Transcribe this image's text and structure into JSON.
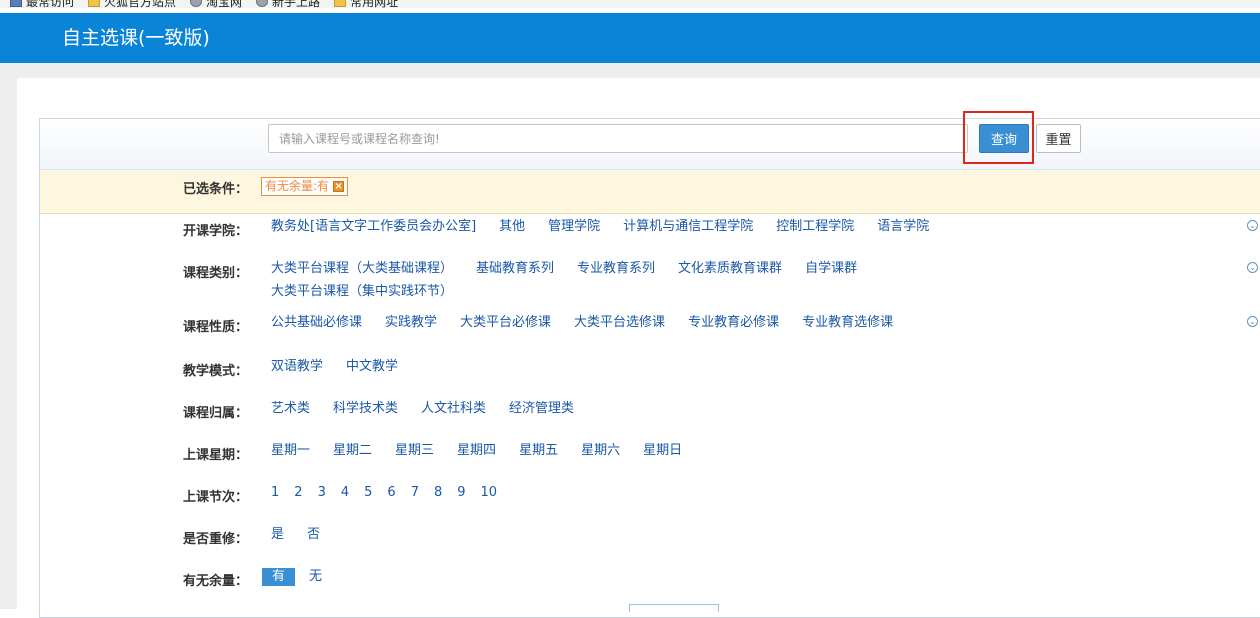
{
  "bookmarks": [
    {
      "label": "最常访问",
      "icon": "bookmark-star-icon"
    },
    {
      "label": "火狐官方站点",
      "icon": "folder-icon"
    },
    {
      "label": "淘宝网",
      "icon": "globe-icon"
    },
    {
      "label": "新手上路",
      "icon": "globe-icon"
    },
    {
      "label": "常用网址",
      "icon": "folder-icon"
    }
  ],
  "header": {
    "title": "自主选课(一致版)",
    "color": "#0a84d7"
  },
  "search": {
    "placeholder": "请输入课程号或课程名称查询!",
    "query_label": "查询",
    "reset_label": "重置"
  },
  "selected": {
    "label": "已选条件：",
    "tag": "有无余量:有"
  },
  "filters": {
    "college": {
      "label": "开课学院：",
      "options": [
        "教务处[语言文字工作委员会办公室]",
        "其他",
        "管理学院",
        "计算机与通信工程学院",
        "控制工程学院",
        "语言学院"
      ]
    },
    "category": {
      "label": "课程类别：",
      "options": [
        "大类平台课程（大类基础课程）",
        "基础教育系列",
        "专业教育系列",
        "文化素质教育课群",
        "自学课群",
        "大类平台课程（集中实践环节）"
      ]
    },
    "nature": {
      "label": "课程性质：",
      "options": [
        "公共基础必修课",
        "实践教学",
        "大类平台必修课",
        "大类平台选修课",
        "专业教育必修课",
        "专业教育选修课"
      ]
    },
    "mode": {
      "label": "教学模式：",
      "options": [
        "双语教学",
        "中文教学"
      ]
    },
    "belong": {
      "label": "课程归属：",
      "options": [
        "艺术类",
        "科学技术类",
        "人文社科类",
        "经济管理类"
      ]
    },
    "weekday": {
      "label": "上课星期：",
      "options": [
        "星期一",
        "星期二",
        "星期三",
        "星期四",
        "星期五",
        "星期六",
        "星期日"
      ]
    },
    "period": {
      "label": "上课节次：",
      "options": [
        "1",
        "2",
        "3",
        "4",
        "5",
        "6",
        "7",
        "8",
        "9",
        "10"
      ]
    },
    "retake": {
      "label": "是否重修：",
      "options": [
        "是",
        "否"
      ]
    },
    "capacity": {
      "label": "有无余量：",
      "options": [
        "有",
        "无"
      ],
      "selected": "有"
    }
  },
  "colors": {
    "accent": "#3a8fd3",
    "link": "#1a58a8",
    "highlight": "#e0251b",
    "tag": "#f08a3c"
  }
}
